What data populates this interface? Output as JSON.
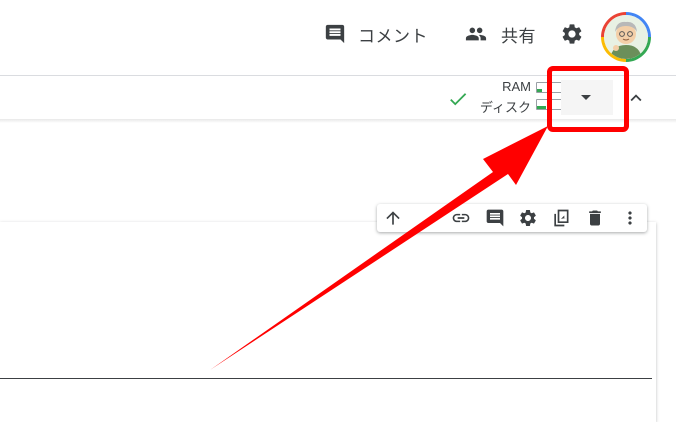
{
  "header": {
    "comment_label": "コメント",
    "share_label": "共有"
  },
  "toolbar": {
    "ram_label": "RAM",
    "disk_label": "ディスク"
  },
  "colors": {
    "accent_red": "#ff0000",
    "status_green": "#34a853",
    "text": "#3c4043"
  },
  "icons": [
    "comment-icon",
    "people-icon",
    "gear-icon",
    "check-icon",
    "caret-down-icon",
    "chevron-up-icon",
    "arrow-up-icon",
    "link-icon",
    "comment-icon",
    "gear-icon",
    "mirror-cell-icon",
    "trash-icon",
    "more-vert-icon"
  ]
}
